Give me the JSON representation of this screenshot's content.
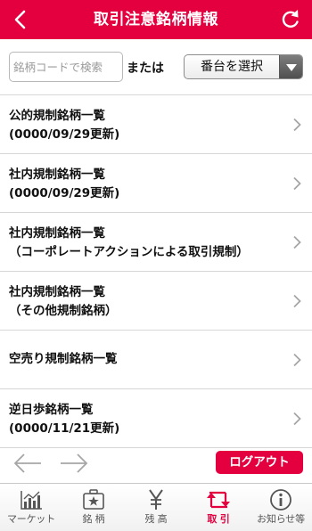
{
  "header": {
    "title": "取引注意銘柄情報"
  },
  "search": {
    "placeholder": "銘柄コードで検索",
    "or_label": "または",
    "select_label": "番台を選択"
  },
  "rows": [
    {
      "line1": "公的規制銘柄一覧",
      "line2": "(0000/09/29更新)"
    },
    {
      "line1": "社内規制銘柄一覧",
      "line2": "(0000/09/29更新)"
    },
    {
      "line1": "社内規制銘柄一覧",
      "line2": "（コーポレートアクションによる取引規制）"
    },
    {
      "line1": "社内規制銘柄一覧",
      "line2": "（その他規制銘柄）"
    },
    {
      "line1": "空売り規制銘柄一覧",
      "line2": ""
    },
    {
      "line1": "逆日歩銘柄一覧",
      "line2": "(0000/11/21更新)"
    }
  ],
  "logout_label": "ログアウト",
  "tabs": [
    {
      "label": "マーケット",
      "icon": "chart-icon",
      "active": false
    },
    {
      "label": "銘 柄",
      "icon": "briefcase-star-icon",
      "active": false
    },
    {
      "label": "残 高",
      "icon": "yen-icon",
      "active": false
    },
    {
      "label": "取 引",
      "icon": "trade-arrows-icon",
      "active": true
    },
    {
      "label": "お知らせ等",
      "icon": "info-icon",
      "active": false
    }
  ],
  "colors": {
    "brand": "#e4003f",
    "arrow_gray": "#a6a6a6"
  }
}
